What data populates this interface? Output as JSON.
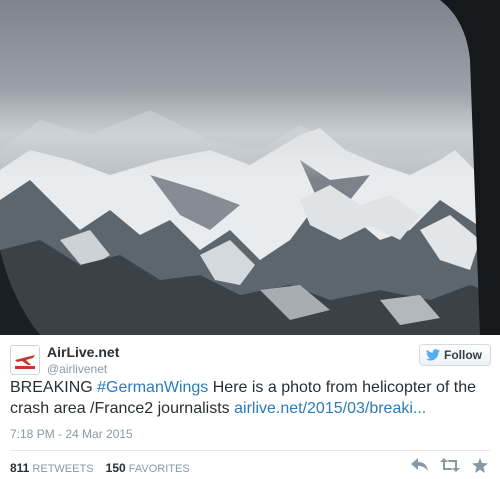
{
  "author": {
    "name": "AirLive.net",
    "handle": "@airlivenet",
    "avatar_text": "AirLive.net"
  },
  "follow_button": {
    "label": "Follow"
  },
  "tweet": {
    "prefix": "BREAKING ",
    "hashtag": "#GermanWings",
    "body": " Here is a photo from helicopter of the crash area /France2 journalists ",
    "link": "airlive.net/2015/03/breaki..."
  },
  "timestamp": "7:18 PM - 24 Mar 2015",
  "stats": {
    "retweets_count": "811",
    "retweets_label": "RETWEETS",
    "favorites_count": "150",
    "favorites_label": "FAVORITES"
  },
  "icons": {
    "follow": "twitter-bird-icon",
    "reply": "reply-icon",
    "retweet": "retweet-icon",
    "favorite": "star-icon"
  },
  "colors": {
    "link": "#2b7bb9",
    "meta": "#8899a6",
    "text": "#292f33"
  }
}
